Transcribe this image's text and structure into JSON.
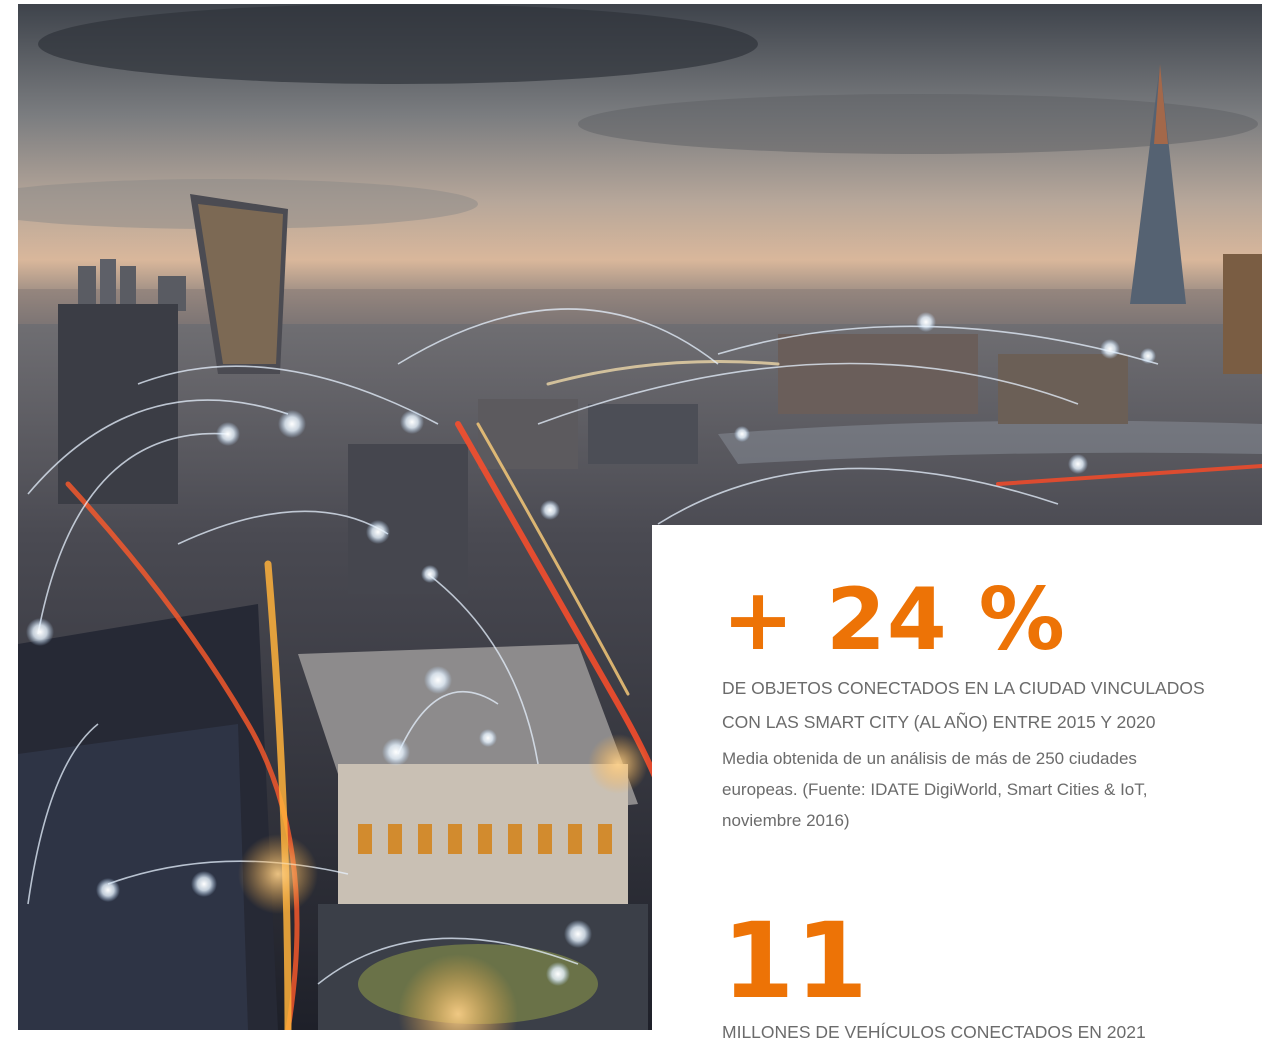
{
  "stats": [
    {
      "value": "+ 24 %",
      "label_line1": "DE OBJETOS CONECTADOS EN LA CIUDAD VINCULADOS",
      "label_line2": "CON LAS SMART CITY (AL AÑO) ENTRE 2015 Y 2020",
      "note_line1": "Media obtenida de un análisis de más de 250 ciudades",
      "note_line2": "europeas. (Fuente: IDATE DigiWorld, Smart Cities & IoT,",
      "note_line3": "noviembre 2016)"
    },
    {
      "value": "11",
      "label_line1": "MILLONES DE VEHÍCULOS CONECTADOS EN 2021"
    }
  ],
  "colors": {
    "accent": "#ed7306",
    "text_gray": "#6b6b6b"
  }
}
